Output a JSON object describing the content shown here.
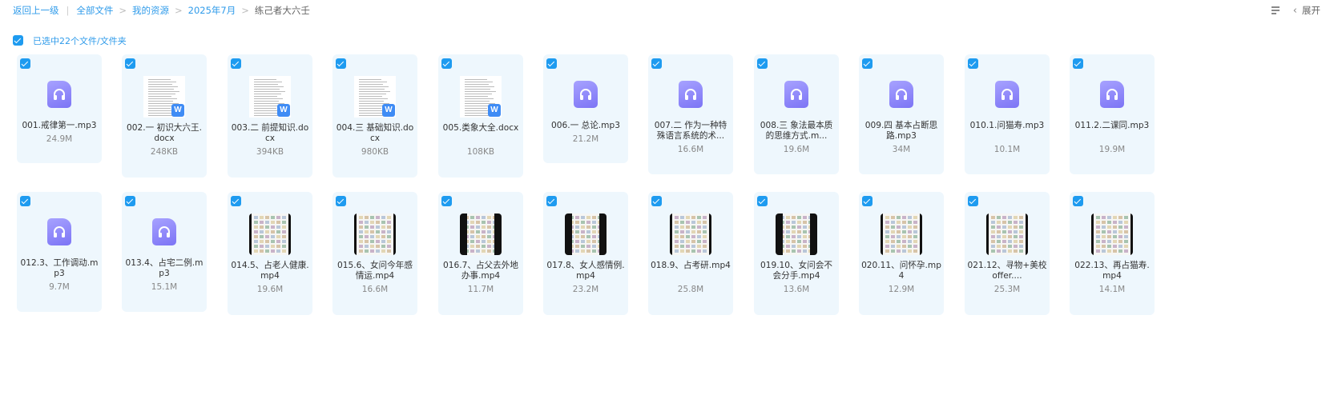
{
  "breadcrumb": {
    "back": "返回上一级",
    "items": [
      "全部文件",
      "我的资源",
      "2025年7月"
    ],
    "current": "练己者大六壬"
  },
  "toolbar": {
    "expand_label": "展开"
  },
  "selection": {
    "label": "已选中22个文件/文件夹",
    "checked": true
  },
  "colors": {
    "accent": "#2f9bea",
    "checkbox": "#1e9bf0",
    "card_bg": "#eef7fd",
    "audio_icon": "#8e88fb",
    "word_badge": "#3f8cf5"
  },
  "files": [
    {
      "type": "audio",
      "name": "001.戒律第一.mp3",
      "size": "24.9M",
      "checked": true
    },
    {
      "type": "doc",
      "name": "002.一 初识大六王.docx",
      "size": "248KB",
      "checked": true
    },
    {
      "type": "doc",
      "name": "003.二 前提知识.docx",
      "size": "394KB",
      "checked": true
    },
    {
      "type": "doc",
      "name": "004.三 基础知识.docx",
      "size": "980KB",
      "checked": true
    },
    {
      "type": "doc",
      "name": "005.类象大全.docx",
      "size": "108KB",
      "checked": true
    },
    {
      "type": "audio",
      "name": "006.一 总论.mp3",
      "size": "21.2M",
      "checked": true
    },
    {
      "type": "audio",
      "name": "007.二 作为一种特殊语言系统的术...",
      "size": "16.6M",
      "checked": true
    },
    {
      "type": "audio",
      "name": "008.三 象法最本质的思维方式.m...",
      "size": "19.6M",
      "checked": true
    },
    {
      "type": "audio",
      "name": "009.四 基本占断思路.mp3",
      "size": "34M",
      "checked": true
    },
    {
      "type": "audio",
      "name": "010.1.问猫寿.mp3",
      "size": "10.1M",
      "checked": true
    },
    {
      "type": "audio",
      "name": "011.2.二课同.mp3",
      "size": "19.9M",
      "checked": true
    },
    {
      "type": "audio",
      "name": "012.3、工作调动.mp3",
      "size": "9.7M",
      "checked": true
    },
    {
      "type": "audio",
      "name": "013.4、占宅二例.mp3",
      "size": "15.1M",
      "checked": true
    },
    {
      "type": "video",
      "name": "014.5、占老人健康.mp4",
      "size": "19.6M",
      "checked": true
    },
    {
      "type": "video",
      "name": "015.6、女问今年感情运.mp4",
      "size": "16.6M",
      "checked": true
    },
    {
      "type": "video",
      "name": "016.7、占父去外地办事.mp4",
      "size": "11.7M",
      "checked": true
    },
    {
      "type": "video",
      "name": "017.8、女人感情例.mp4",
      "size": "23.2M",
      "checked": true
    },
    {
      "type": "video",
      "name": "018.9、占考研.mp4",
      "size": "25.8M",
      "checked": true
    },
    {
      "type": "video",
      "name": "019.10、女问会不会分手.mp4",
      "size": "13.6M",
      "checked": true
    },
    {
      "type": "video",
      "name": "020.11、问怀孕.mp4",
      "size": "12.9M",
      "checked": true
    },
    {
      "type": "video",
      "name": "021.12、寻物+美校offer....",
      "size": "25.3M",
      "checked": true
    },
    {
      "type": "video",
      "name": "022.13、再占猫寿.mp4",
      "size": "14.1M",
      "checked": true
    }
  ]
}
